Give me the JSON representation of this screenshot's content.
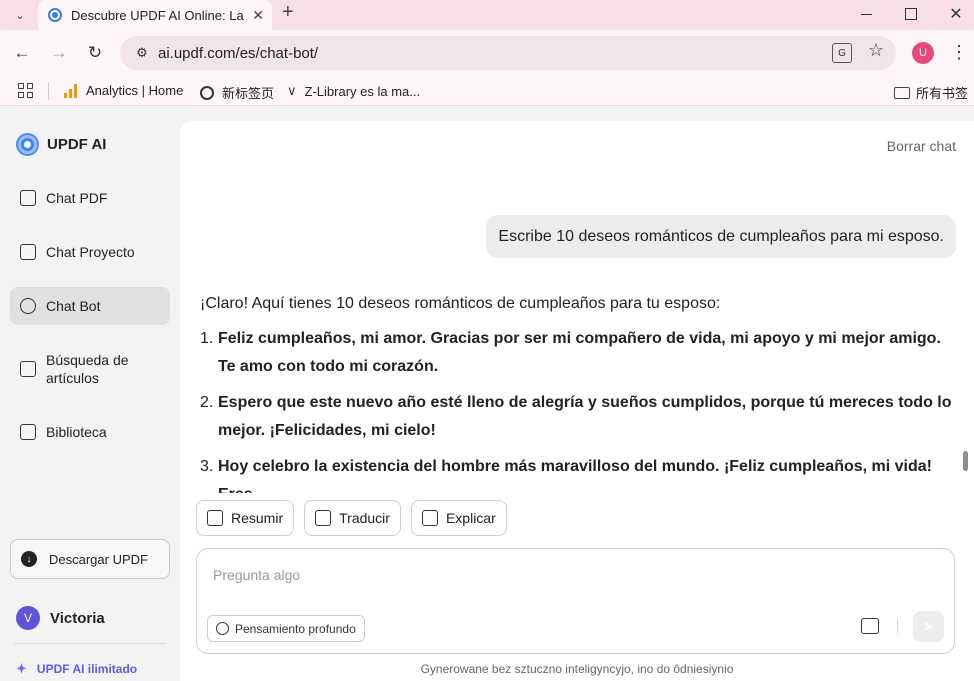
{
  "browser": {
    "tab_title": "Descubre UPDF AI Online: La",
    "tab_menu_icon": "chevron-down-icon",
    "url": "ai.updf.com/es/chat-bot/",
    "bookmarks": [
      {
        "label": "Analytics | Home",
        "icon": "analytics-icon"
      },
      {
        "label": "新标签页",
        "icon": "globe-icon"
      },
      {
        "label": "Z-Library es la ma...",
        "icon": "zlibrary-icon"
      }
    ],
    "bookmarks_folder": "所有书签",
    "profile_initial": "U",
    "profile_color": "#e74a7a"
  },
  "sidebar": {
    "brand": "UPDF AI",
    "items": [
      {
        "label": "Chat PDF",
        "icon": "chat-pdf-icon"
      },
      {
        "label": "Chat Proyecto",
        "icon": "folder-chat-icon"
      },
      {
        "label": "Chat Bot",
        "icon": "chat-bot-icon",
        "active": true
      },
      {
        "label": "Búsqueda de artículos",
        "icon": "search-article-icon"
      },
      {
        "label": "Biblioteca",
        "icon": "library-icon"
      }
    ],
    "download_label": "Descargar UPDF",
    "user_initial": "V",
    "user_name": "Victoria",
    "unlimited_label": "UPDF AI ilimitado",
    "accent_color": "#5b5be4"
  },
  "chat": {
    "clear_label": "Borrar chat",
    "user_message": "Escribe 10 deseos románticos de cumpleaños para mi esposo.",
    "answer_intro": "¡Claro! Aquí tienes 10 deseos románticos de cumpleaños para tu esposo:",
    "wishes": [
      {
        "num": "1.",
        "text": "Feliz cumpleaños, mi amor. Gracias por ser mi compañero de vida, mi apoyo y mi mejor amigo. Te amo con todo mi corazón."
      },
      {
        "num": "2.",
        "text": "Espero que este nuevo año esté lleno de alegría y sueños cumplidos, porque tú mereces todo lo mejor. ¡Felicidades, mi cielo!"
      },
      {
        "num": "3.",
        "text": "Hoy celebro la existencia del hombre más maravilloso del mundo. ¡Feliz cumpleaños, mi vida! Eres"
      }
    ],
    "actions": [
      {
        "label": "Resumir",
        "icon": "summarize-icon"
      },
      {
        "label": "Traducir",
        "icon": "translate-icon"
      },
      {
        "label": "Explicar",
        "icon": "explain-icon"
      }
    ],
    "input_placeholder": "Pregunta algo",
    "deep_think_label": "Pensamiento profundo",
    "disclaimer": "Gynerowane bez sztuczno inteligyncyjo, ino do ôdniesiynio"
  }
}
